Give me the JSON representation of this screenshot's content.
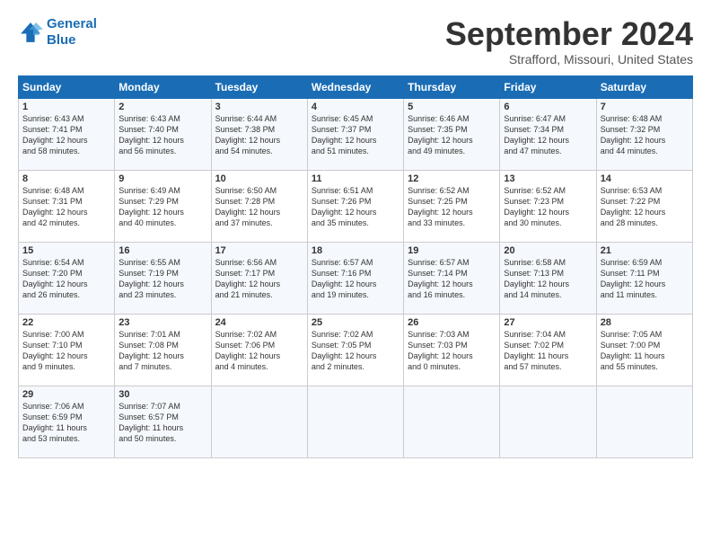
{
  "logo": {
    "line1": "General",
    "line2": "Blue"
  },
  "title": "September 2024",
  "location": "Strafford, Missouri, United States",
  "days_header": [
    "Sunday",
    "Monday",
    "Tuesday",
    "Wednesday",
    "Thursday",
    "Friday",
    "Saturday"
  ],
  "weeks": [
    [
      {
        "day": "1",
        "text": "Sunrise: 6:43 AM\nSunset: 7:41 PM\nDaylight: 12 hours\nand 58 minutes."
      },
      {
        "day": "2",
        "text": "Sunrise: 6:43 AM\nSunset: 7:40 PM\nDaylight: 12 hours\nand 56 minutes."
      },
      {
        "day": "3",
        "text": "Sunrise: 6:44 AM\nSunset: 7:38 PM\nDaylight: 12 hours\nand 54 minutes."
      },
      {
        "day": "4",
        "text": "Sunrise: 6:45 AM\nSunset: 7:37 PM\nDaylight: 12 hours\nand 51 minutes."
      },
      {
        "day": "5",
        "text": "Sunrise: 6:46 AM\nSunset: 7:35 PM\nDaylight: 12 hours\nand 49 minutes."
      },
      {
        "day": "6",
        "text": "Sunrise: 6:47 AM\nSunset: 7:34 PM\nDaylight: 12 hours\nand 47 minutes."
      },
      {
        "day": "7",
        "text": "Sunrise: 6:48 AM\nSunset: 7:32 PM\nDaylight: 12 hours\nand 44 minutes."
      }
    ],
    [
      {
        "day": "8",
        "text": "Sunrise: 6:48 AM\nSunset: 7:31 PM\nDaylight: 12 hours\nand 42 minutes."
      },
      {
        "day": "9",
        "text": "Sunrise: 6:49 AM\nSunset: 7:29 PM\nDaylight: 12 hours\nand 40 minutes."
      },
      {
        "day": "10",
        "text": "Sunrise: 6:50 AM\nSunset: 7:28 PM\nDaylight: 12 hours\nand 37 minutes."
      },
      {
        "day": "11",
        "text": "Sunrise: 6:51 AM\nSunset: 7:26 PM\nDaylight: 12 hours\nand 35 minutes."
      },
      {
        "day": "12",
        "text": "Sunrise: 6:52 AM\nSunset: 7:25 PM\nDaylight: 12 hours\nand 33 minutes."
      },
      {
        "day": "13",
        "text": "Sunrise: 6:52 AM\nSunset: 7:23 PM\nDaylight: 12 hours\nand 30 minutes."
      },
      {
        "day": "14",
        "text": "Sunrise: 6:53 AM\nSunset: 7:22 PM\nDaylight: 12 hours\nand 28 minutes."
      }
    ],
    [
      {
        "day": "15",
        "text": "Sunrise: 6:54 AM\nSunset: 7:20 PM\nDaylight: 12 hours\nand 26 minutes."
      },
      {
        "day": "16",
        "text": "Sunrise: 6:55 AM\nSunset: 7:19 PM\nDaylight: 12 hours\nand 23 minutes."
      },
      {
        "day": "17",
        "text": "Sunrise: 6:56 AM\nSunset: 7:17 PM\nDaylight: 12 hours\nand 21 minutes."
      },
      {
        "day": "18",
        "text": "Sunrise: 6:57 AM\nSunset: 7:16 PM\nDaylight: 12 hours\nand 19 minutes."
      },
      {
        "day": "19",
        "text": "Sunrise: 6:57 AM\nSunset: 7:14 PM\nDaylight: 12 hours\nand 16 minutes."
      },
      {
        "day": "20",
        "text": "Sunrise: 6:58 AM\nSunset: 7:13 PM\nDaylight: 12 hours\nand 14 minutes."
      },
      {
        "day": "21",
        "text": "Sunrise: 6:59 AM\nSunset: 7:11 PM\nDaylight: 12 hours\nand 11 minutes."
      }
    ],
    [
      {
        "day": "22",
        "text": "Sunrise: 7:00 AM\nSunset: 7:10 PM\nDaylight: 12 hours\nand 9 minutes."
      },
      {
        "day": "23",
        "text": "Sunrise: 7:01 AM\nSunset: 7:08 PM\nDaylight: 12 hours\nand 7 minutes."
      },
      {
        "day": "24",
        "text": "Sunrise: 7:02 AM\nSunset: 7:06 PM\nDaylight: 12 hours\nand 4 minutes."
      },
      {
        "day": "25",
        "text": "Sunrise: 7:02 AM\nSunset: 7:05 PM\nDaylight: 12 hours\nand 2 minutes."
      },
      {
        "day": "26",
        "text": "Sunrise: 7:03 AM\nSunset: 7:03 PM\nDaylight: 12 hours\nand 0 minutes."
      },
      {
        "day": "27",
        "text": "Sunrise: 7:04 AM\nSunset: 7:02 PM\nDaylight: 11 hours\nand 57 minutes."
      },
      {
        "day": "28",
        "text": "Sunrise: 7:05 AM\nSunset: 7:00 PM\nDaylight: 11 hours\nand 55 minutes."
      }
    ],
    [
      {
        "day": "29",
        "text": "Sunrise: 7:06 AM\nSunset: 6:59 PM\nDaylight: 11 hours\nand 53 minutes."
      },
      {
        "day": "30",
        "text": "Sunrise: 7:07 AM\nSunset: 6:57 PM\nDaylight: 11 hours\nand 50 minutes."
      },
      {
        "day": "",
        "text": ""
      },
      {
        "day": "",
        "text": ""
      },
      {
        "day": "",
        "text": ""
      },
      {
        "day": "",
        "text": ""
      },
      {
        "day": "",
        "text": ""
      }
    ]
  ]
}
